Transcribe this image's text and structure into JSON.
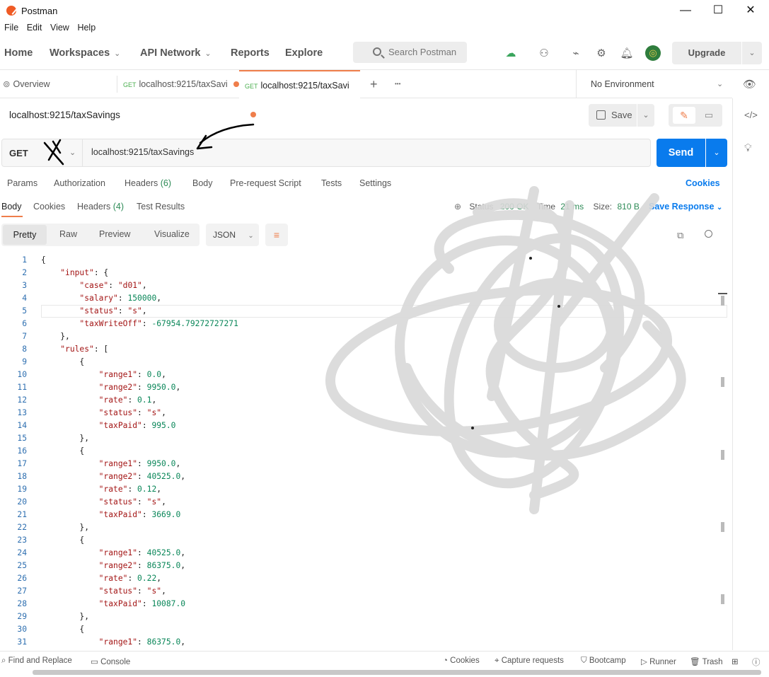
{
  "window": {
    "title": "Postman",
    "minimize": "—",
    "maximize": "☐",
    "close": "✕"
  },
  "menu": [
    "File",
    "Edit",
    "View",
    "Help"
  ],
  "header": {
    "home": "Home",
    "workspaces": "Workspaces",
    "api_network": "API Network",
    "reports": "Reports",
    "explore": "Explore",
    "search_placeholder": "Search Postman",
    "upgrade": "Upgrade"
  },
  "tabs": {
    "overview": "Overview",
    "tab1": {
      "method": "GET",
      "url": "localhost:9215/taxSavi"
    },
    "tab2": {
      "method": "GET",
      "url": "localhost:9215/taxSavi"
    },
    "add": "+",
    "more": "•••"
  },
  "environment": "No Environment",
  "request": {
    "name": "localhost:9215/taxSavings",
    "save": "Save",
    "method": "GET",
    "url": "localhost:9215/taxSavings",
    "send": "Send"
  },
  "request_tabs": {
    "params": "Params",
    "authorization": "Authorization",
    "headers": "Headers",
    "headers_count": "(6)",
    "body": "Body",
    "prerequest": "Pre-request Script",
    "tests": "Tests",
    "settings": "Settings",
    "cookies": "Cookies"
  },
  "response_tabs": {
    "body": "Body",
    "cookies": "Cookies",
    "headers": "Headers",
    "headers_count": "(4)",
    "test_results": "Test Results"
  },
  "response_status": {
    "status_label": "Status",
    "status_value": "200 OK",
    "time_label": "Time",
    "time_value": "21 ms",
    "size_label": "Size:",
    "size_value": "810 B",
    "save_response": "Save Response"
  },
  "format": {
    "pretty": "Pretty",
    "raw": "Raw",
    "preview": "Preview",
    "visualize": "Visualize",
    "language": "JSON"
  },
  "code_lines": [
    "{",
    "    \"input\": {",
    "        \"case\": \"d01\",",
    "        \"salary\": 150000,",
    "        \"status\": \"s\",",
    "        \"taxWriteOff\": -67954.79272727271",
    "    },",
    "    \"rules\": [",
    "        {",
    "            \"range1\": 0.0,",
    "            \"range2\": 9950.0,",
    "            \"rate\": 0.1,",
    "            \"status\": \"s\",",
    "            \"taxPaid\": 995.0",
    "        },",
    "        {",
    "            \"range1\": 9950.0,",
    "            \"range2\": 40525.0,",
    "            \"rate\": 0.12,",
    "            \"status\": \"s\",",
    "            \"taxPaid\": 3669.0",
    "        },",
    "        {",
    "            \"range1\": 40525.0,",
    "            \"range2\": 86375.0,",
    "            \"rate\": 0.22,",
    "            \"status\": \"s\",",
    "            \"taxPaid\": 10087.0",
    "        },",
    "        {",
    "            \"range1\": 86375.0,"
  ],
  "statusbar": {
    "find_replace": "Find and Replace",
    "console": "Console",
    "cookies": "Cookies",
    "capture": "Capture requests",
    "bootcamp": "Bootcamp",
    "runner": "Runner",
    "trash": "Trash"
  },
  "colors": {
    "accent": "#ef7e4b",
    "send_blue": "#097bed",
    "ok_green": "#2e8b57"
  }
}
